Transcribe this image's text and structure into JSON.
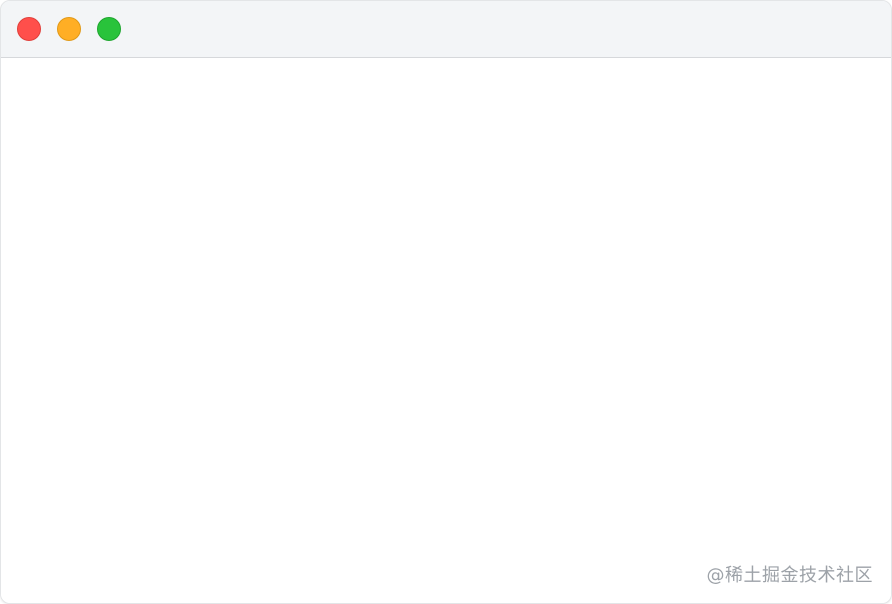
{
  "window": {
    "controls": [
      {
        "name": "close",
        "color": "#ff4f4b"
      },
      {
        "name": "minimize",
        "color": "#ffae25"
      },
      {
        "name": "maximize",
        "color": "#29c33b"
      }
    ]
  },
  "watermark": {
    "text": "@稀土掘金技术社区"
  }
}
